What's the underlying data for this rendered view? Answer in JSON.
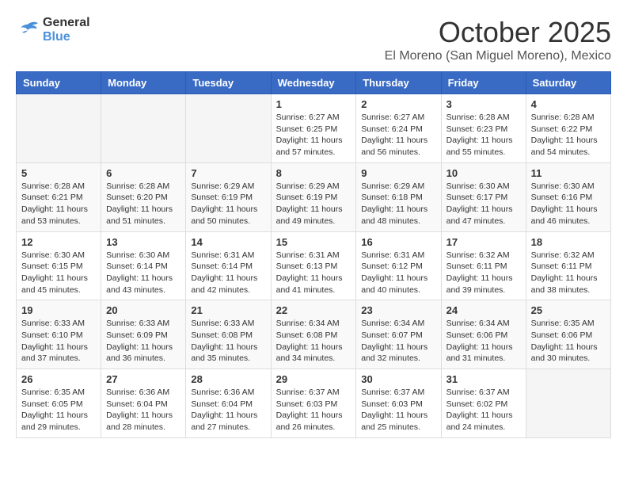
{
  "header": {
    "logo_general": "General",
    "logo_blue": "Blue",
    "month_title": "October 2025",
    "location": "El Moreno (San Miguel Moreno), Mexico"
  },
  "days_of_week": [
    "Sunday",
    "Monday",
    "Tuesday",
    "Wednesday",
    "Thursday",
    "Friday",
    "Saturday"
  ],
  "weeks": [
    [
      {
        "day": "",
        "info": ""
      },
      {
        "day": "",
        "info": ""
      },
      {
        "day": "",
        "info": ""
      },
      {
        "day": "1",
        "info": "Sunrise: 6:27 AM\nSunset: 6:25 PM\nDaylight: 11 hours and 57 minutes."
      },
      {
        "day": "2",
        "info": "Sunrise: 6:27 AM\nSunset: 6:24 PM\nDaylight: 11 hours and 56 minutes."
      },
      {
        "day": "3",
        "info": "Sunrise: 6:28 AM\nSunset: 6:23 PM\nDaylight: 11 hours and 55 minutes."
      },
      {
        "day": "4",
        "info": "Sunrise: 6:28 AM\nSunset: 6:22 PM\nDaylight: 11 hours and 54 minutes."
      }
    ],
    [
      {
        "day": "5",
        "info": "Sunrise: 6:28 AM\nSunset: 6:21 PM\nDaylight: 11 hours and 53 minutes."
      },
      {
        "day": "6",
        "info": "Sunrise: 6:28 AM\nSunset: 6:20 PM\nDaylight: 11 hours and 51 minutes."
      },
      {
        "day": "7",
        "info": "Sunrise: 6:29 AM\nSunset: 6:19 PM\nDaylight: 11 hours and 50 minutes."
      },
      {
        "day": "8",
        "info": "Sunrise: 6:29 AM\nSunset: 6:19 PM\nDaylight: 11 hours and 49 minutes."
      },
      {
        "day": "9",
        "info": "Sunrise: 6:29 AM\nSunset: 6:18 PM\nDaylight: 11 hours and 48 minutes."
      },
      {
        "day": "10",
        "info": "Sunrise: 6:30 AM\nSunset: 6:17 PM\nDaylight: 11 hours and 47 minutes."
      },
      {
        "day": "11",
        "info": "Sunrise: 6:30 AM\nSunset: 6:16 PM\nDaylight: 11 hours and 46 minutes."
      }
    ],
    [
      {
        "day": "12",
        "info": "Sunrise: 6:30 AM\nSunset: 6:15 PM\nDaylight: 11 hours and 45 minutes."
      },
      {
        "day": "13",
        "info": "Sunrise: 6:30 AM\nSunset: 6:14 PM\nDaylight: 11 hours and 43 minutes."
      },
      {
        "day": "14",
        "info": "Sunrise: 6:31 AM\nSunset: 6:14 PM\nDaylight: 11 hours and 42 minutes."
      },
      {
        "day": "15",
        "info": "Sunrise: 6:31 AM\nSunset: 6:13 PM\nDaylight: 11 hours and 41 minutes."
      },
      {
        "day": "16",
        "info": "Sunrise: 6:31 AM\nSunset: 6:12 PM\nDaylight: 11 hours and 40 minutes."
      },
      {
        "day": "17",
        "info": "Sunrise: 6:32 AM\nSunset: 6:11 PM\nDaylight: 11 hours and 39 minutes."
      },
      {
        "day": "18",
        "info": "Sunrise: 6:32 AM\nSunset: 6:11 PM\nDaylight: 11 hours and 38 minutes."
      }
    ],
    [
      {
        "day": "19",
        "info": "Sunrise: 6:33 AM\nSunset: 6:10 PM\nDaylight: 11 hours and 37 minutes."
      },
      {
        "day": "20",
        "info": "Sunrise: 6:33 AM\nSunset: 6:09 PM\nDaylight: 11 hours and 36 minutes."
      },
      {
        "day": "21",
        "info": "Sunrise: 6:33 AM\nSunset: 6:08 PM\nDaylight: 11 hours and 35 minutes."
      },
      {
        "day": "22",
        "info": "Sunrise: 6:34 AM\nSunset: 6:08 PM\nDaylight: 11 hours and 34 minutes."
      },
      {
        "day": "23",
        "info": "Sunrise: 6:34 AM\nSunset: 6:07 PM\nDaylight: 11 hours and 32 minutes."
      },
      {
        "day": "24",
        "info": "Sunrise: 6:34 AM\nSunset: 6:06 PM\nDaylight: 11 hours and 31 minutes."
      },
      {
        "day": "25",
        "info": "Sunrise: 6:35 AM\nSunset: 6:06 PM\nDaylight: 11 hours and 30 minutes."
      }
    ],
    [
      {
        "day": "26",
        "info": "Sunrise: 6:35 AM\nSunset: 6:05 PM\nDaylight: 11 hours and 29 minutes."
      },
      {
        "day": "27",
        "info": "Sunrise: 6:36 AM\nSunset: 6:04 PM\nDaylight: 11 hours and 28 minutes."
      },
      {
        "day": "28",
        "info": "Sunrise: 6:36 AM\nSunset: 6:04 PM\nDaylight: 11 hours and 27 minutes."
      },
      {
        "day": "29",
        "info": "Sunrise: 6:37 AM\nSunset: 6:03 PM\nDaylight: 11 hours and 26 minutes."
      },
      {
        "day": "30",
        "info": "Sunrise: 6:37 AM\nSunset: 6:03 PM\nDaylight: 11 hours and 25 minutes."
      },
      {
        "day": "31",
        "info": "Sunrise: 6:37 AM\nSunset: 6:02 PM\nDaylight: 11 hours and 24 minutes."
      },
      {
        "day": "",
        "info": ""
      }
    ]
  ]
}
